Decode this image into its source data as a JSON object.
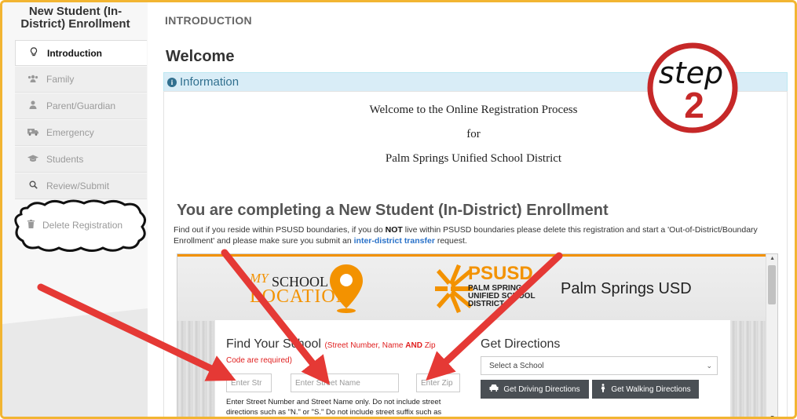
{
  "sidebar": {
    "title": "New Student (In-District) Enrollment",
    "items": [
      {
        "label": "Introduction",
        "icon": "lightbulb-icon",
        "active": true
      },
      {
        "label": "Family",
        "icon": "users-icon"
      },
      {
        "label": "Parent/Guardian",
        "icon": "user-icon"
      },
      {
        "label": "Emergency",
        "icon": "ambulance-icon"
      },
      {
        "label": "Students",
        "icon": "graduation-cap-icon"
      },
      {
        "label": "Review/Submit",
        "icon": "search-icon"
      }
    ],
    "delete_label": "Delete Registration"
  },
  "main": {
    "section": "INTRODUCTION",
    "heading": "Welcome",
    "info_label": "Information",
    "welcome_lines": [
      "Welcome to the Online Registration Process",
      "for",
      "Palm Springs Unified School District"
    ],
    "completing": "You are completing a New Student (In-District) Enrollment",
    "find_out_1": "Find out if you reside within PSUSD boundaries, if you do ",
    "find_out_not": "NOT",
    "find_out_2": " live within PSUSD boundaries please delete this registration and start a 'Out-of-District/Boundary Enrollment' and please make sure you submit an ",
    "find_out_link": "inter-district transfer",
    "find_out_3": " request."
  },
  "embed": {
    "logo_my": "MY",
    "logo_school": "SCHOOL",
    "logo_location": "LOCATION",
    "psusd": "PSUSD",
    "psusd_sub": "PALM SPRINGS UNIFIED SCHOOL DISTRICT",
    "psusd_full": "Palm Springs USD",
    "find_title": "Find Your School",
    "find_req_a": "(Street Number, Name ",
    "find_req_and": "AND",
    "find_req_b": " Zip",
    "find_req_line2": "Code are required)",
    "placeholder_number": "Enter Str",
    "placeholder_street": "Enter Street Name",
    "placeholder_zip": "Enter Zip",
    "help_text": "Enter Street Number and Street Name only. Do not include street directions such as \"N.\" or \"S.\" Do not include street suffix such as",
    "directions_title": "Get Directions",
    "select_school": "Select a School",
    "driving_btn": "Get Driving Directions",
    "walking_btn": "Get Walking Directions"
  },
  "annotation": {
    "step_word": "step",
    "step_number": "2"
  },
  "colors": {
    "frame": "#f2b532",
    "accent_orange": "#f39200",
    "info_bg": "#d9edf7",
    "arrow_red": "#e53935",
    "badge_red": "#c62828"
  }
}
